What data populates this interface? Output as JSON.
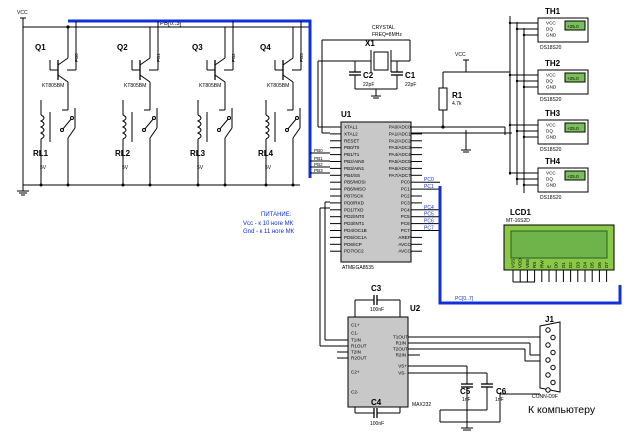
{
  "vcc": "VCC",
  "bus_top": "PB[0..3]",
  "bus_bottom": "PC[0..7]",
  "transistors": [
    {
      "ref": "Q1",
      "part": "KT805BM"
    },
    {
      "ref": "Q2",
      "part": "KT805BM"
    },
    {
      "ref": "Q3",
      "part": "KT805BM"
    },
    {
      "ref": "Q4",
      "part": "KT805BM"
    }
  ],
  "relays": [
    {
      "ref": "RL1",
      "voltage": "5V"
    },
    {
      "ref": "RL2",
      "voltage": "5V"
    },
    {
      "ref": "RL3",
      "voltage": "5V"
    },
    {
      "ref": "RL4",
      "voltage": "5V"
    }
  ],
  "pb_labels": [
    "PB0",
    "PB1",
    "PB2",
    "PB3"
  ],
  "crystal": {
    "ref": "X1",
    "label": "CRYSTAL",
    "freq": "FREQ=8MHz"
  },
  "caps": {
    "c1": {
      "ref": "C1",
      "value": "22pF"
    },
    "c2": {
      "ref": "C2",
      "value": "22pF"
    },
    "c3": {
      "ref": "C3",
      "value": "100nF"
    },
    "c4": {
      "ref": "C4",
      "value": "100nF"
    },
    "c5": {
      "ref": "C5",
      "value": "1nF"
    },
    "c6": {
      "ref": "C6",
      "value": "1nF"
    }
  },
  "r1": {
    "ref": "R1",
    "value": "4.7k"
  },
  "mcu": {
    "ref": "U1",
    "part": "ATMEGA8535",
    "left_pins": [
      "XTAL1",
      "XTAL2",
      "RESET",
      "PB0/T0",
      "PB1/T1",
      "PB2/AIN0",
      "PB3/AIN1",
      "PB4/SS",
      "PB5/MOSI",
      "PB6/MISO",
      "PB7/SCK",
      "PD0/RXD",
      "PD1/TXD",
      "PD2/INT0",
      "PD3/INT1",
      "PD4/OC1B",
      "PD5/OC1A",
      "PD6/ICP",
      "PD7/OC2"
    ],
    "right_pins": [
      "PA0/ADC0",
      "PA1/ADC1",
      "PA2/ADC2",
      "PA3/ADC3",
      "PA4/ADC4",
      "PA5/ADC5",
      "PA6/ADC6",
      "PA7/ADC7",
      "PC0",
      "PC1",
      "PC2",
      "PC3",
      "PC4",
      "PC5",
      "PC6",
      "PC7",
      "AREF",
      "AVCC",
      "AVCC"
    ],
    "pc_labels": [
      "PC0",
      "PC1",
      "PC4",
      "PC5",
      "PC6",
      "PC7"
    ]
  },
  "power_note": [
    "ПИТАНИЕ:",
    "Vcc - к 10 ноге МК",
    "Gnd - к 11 ноге МК"
  ],
  "sensors": [
    {
      "ref": "TH1",
      "part": "DS18S20",
      "pins": [
        "VCC",
        "DQ",
        "GND"
      ],
      "reading": "+25.0"
    },
    {
      "ref": "TH2",
      "part": "DS18S20",
      "pins": [
        "VCC",
        "DQ",
        "GND"
      ],
      "reading": "+25.0"
    },
    {
      "ref": "TH3",
      "part": "DS18S20",
      "pins": [
        "VCC",
        "DQ",
        "GND"
      ],
      "reading": "+25.0"
    },
    {
      "ref": "TH4",
      "part": "DS18S20",
      "pins": [
        "VCC",
        "DQ",
        "GND"
      ],
      "reading": "+25.0"
    }
  ],
  "lcd": {
    "ref": "LCD1",
    "part": "MT-16S2D",
    "pins": [
      "VSS",
      "VDD",
      "VEE",
      "RS",
      "RW",
      "E",
      "D0",
      "D1",
      "D2",
      "D3",
      "D4",
      "D5",
      "D6",
      "D7"
    ]
  },
  "max232": {
    "ref": "U2",
    "part": "MAX232",
    "left_pins": [
      "C1+",
      "C1-",
      "T1IN",
      "R1OUT",
      "T2IN",
      "R2OUT",
      "C2+",
      "C2-"
    ],
    "right_pins": [
      "T1OUT",
      "R1IN",
      "T2OUT",
      "R2IN",
      "VS+",
      "VS-"
    ]
  },
  "connector": {
    "ref": "J1",
    "part": "CONN-D9F"
  },
  "computer_label": "К компьютеру",
  "colors": {
    "wire": "#000000",
    "bus": "#1030d8",
    "chip_fill": "#c8c8c8",
    "lcd_screen": "#8ac948",
    "sensor_screen": "#7ac05a"
  }
}
